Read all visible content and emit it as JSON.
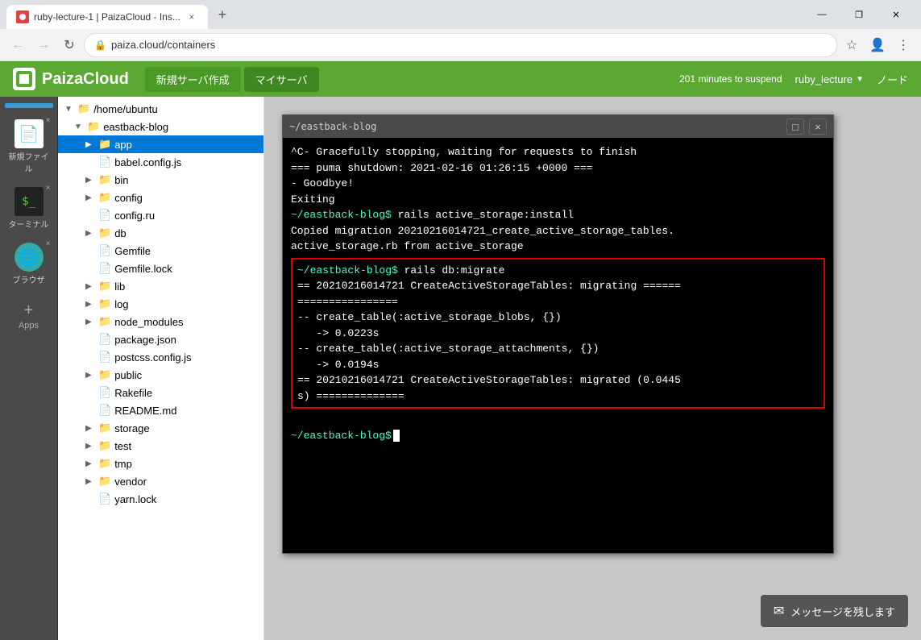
{
  "browser": {
    "tab_title": "ruby-lecture-1 | PaizaCloud - Ins...",
    "tab_close": "×",
    "new_tab": "+",
    "address": "paiza.cloud/containers",
    "win_minimize": "—",
    "win_maximize": "❐",
    "win_close": "✕",
    "back_icon": "←",
    "forward_icon": "→",
    "refresh_icon": "↻"
  },
  "paiza": {
    "logo_text": "PaizaCloud",
    "nav_new_server": "新規サーバ作成",
    "nav_my_server": "マイサーバ",
    "user": "ruby_lecture",
    "suspend_text": "201 minutes to suspend",
    "toolbar_label": "ノード"
  },
  "sidebar_icons": [
    {
      "id": "new-file",
      "label": "新規ファイル",
      "has_close": true
    },
    {
      "id": "terminal",
      "label": "ターミナル",
      "has_close": true
    },
    {
      "id": "browser",
      "label": "ブラウザ",
      "has_close": true
    },
    {
      "id": "apps",
      "label": "Apps",
      "is_add": true
    }
  ],
  "file_tree": {
    "root": "/home/ubuntu",
    "items": [
      {
        "id": "eastback-blog",
        "name": "eastback-blog",
        "type": "folder",
        "indent": 1,
        "expanded": true
      },
      {
        "id": "app",
        "name": "app",
        "type": "folder",
        "indent": 2,
        "expanded": false,
        "selected": true
      },
      {
        "id": "babel.config.js",
        "name": "babel.config.js",
        "type": "file",
        "indent": 2
      },
      {
        "id": "bin",
        "name": "bin",
        "type": "folder",
        "indent": 2,
        "expanded": false
      },
      {
        "id": "config",
        "name": "config",
        "type": "folder",
        "indent": 2,
        "expanded": false
      },
      {
        "id": "config.ru",
        "name": "config.ru",
        "type": "file",
        "indent": 2
      },
      {
        "id": "db",
        "name": "db",
        "type": "folder",
        "indent": 2,
        "expanded": false
      },
      {
        "id": "Gemfile",
        "name": "Gemfile",
        "type": "file",
        "indent": 2
      },
      {
        "id": "Gemfile.lock",
        "name": "Gemfile.lock",
        "type": "file",
        "indent": 2
      },
      {
        "id": "lib",
        "name": "lib",
        "type": "folder",
        "indent": 2,
        "expanded": false
      },
      {
        "id": "log",
        "name": "log",
        "type": "folder",
        "indent": 2,
        "expanded": false
      },
      {
        "id": "node_modules",
        "name": "node_modules",
        "type": "folder",
        "indent": 2,
        "expanded": false
      },
      {
        "id": "package.json",
        "name": "package.json",
        "type": "file",
        "indent": 2
      },
      {
        "id": "postcss.config.js",
        "name": "postcss.config.js",
        "type": "file",
        "indent": 2
      },
      {
        "id": "public",
        "name": "public",
        "type": "folder",
        "indent": 2,
        "expanded": false
      },
      {
        "id": "Rakefile",
        "name": "Rakefile",
        "type": "file",
        "indent": 2
      },
      {
        "id": "README.md",
        "name": "README.md",
        "type": "file",
        "indent": 2
      },
      {
        "id": "storage",
        "name": "storage",
        "type": "folder",
        "indent": 2,
        "expanded": false
      },
      {
        "id": "test",
        "name": "test",
        "type": "folder",
        "indent": 2,
        "expanded": false
      },
      {
        "id": "tmp",
        "name": "tmp",
        "type": "folder",
        "indent": 2,
        "expanded": false
      },
      {
        "id": "vendor",
        "name": "vendor",
        "type": "folder",
        "indent": 2,
        "expanded": false
      },
      {
        "id": "yarn.lock",
        "name": "yarn.lock",
        "type": "file",
        "indent": 2
      }
    ]
  },
  "terminal": {
    "title": "~/eastback-blog",
    "lines": [
      {
        "type": "normal",
        "text": "^C- Gracefully stopping, waiting for requests to finish"
      },
      {
        "type": "normal",
        "text": "=== puma shutdown: 2021-02-16 01:26:15 +0000 ==="
      },
      {
        "type": "normal",
        "text": "- Goodbye!"
      },
      {
        "type": "normal",
        "text": "Exiting"
      },
      {
        "type": "prompt",
        "text": "~/eastback-blog$ rails active_storage:install"
      },
      {
        "type": "normal",
        "text": "Copied migration 20210216014721_create_active_storage_tables."
      },
      {
        "type": "normal",
        "text": "active_storage.rb from active_storage"
      }
    ],
    "highlighted_lines": [
      {
        "type": "prompt",
        "text": "~/eastback-blog$ rails db:migrate"
      },
      {
        "type": "normal",
        "text": "== 20210216014721 CreateActiveStorageTables: migrating ======"
      },
      {
        "type": "normal",
        "text": "================"
      },
      {
        "type": "normal",
        "text": "-- create_table(:active_storage_blobs, {})"
      },
      {
        "type": "normal",
        "text": "   -> 0.0223s"
      },
      {
        "type": "normal",
        "text": "-- create_table(:active_storage_attachments, {})"
      },
      {
        "type": "normal",
        "text": "   -> 0.0194s"
      },
      {
        "type": "normal",
        "text": "== 20210216014721 CreateActiveStorageTables: migrated (0.0445"
      },
      {
        "type": "normal",
        "text": "s) =============="
      }
    ],
    "prompt_line": "~/eastback-blog$ ",
    "message_btn": "メッセージを残します"
  }
}
